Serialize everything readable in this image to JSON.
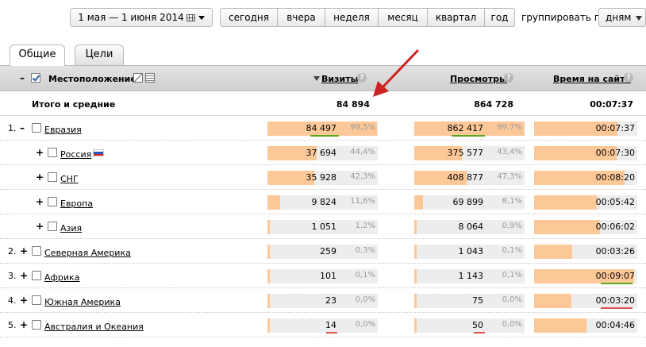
{
  "toolbar": {
    "date_range": "1 мая — 1 июня 2014",
    "periods": [
      "сегодня",
      "вчера",
      "неделя",
      "месяц",
      "квартал",
      "год"
    ],
    "group_label": "группировать по",
    "group_value": "дням"
  },
  "tabs": [
    "Общие",
    "Цели"
  ],
  "header": {
    "dimension": "Местоположение",
    "collapse": "–",
    "visits": "Визиты",
    "views": "Просмотры",
    "time": "Время на сайте",
    "help": "?"
  },
  "totals": {
    "label": "Итого и средние",
    "visits": "84 894",
    "views": "864 728",
    "time": "00:07:37"
  },
  "rows": [
    {
      "num": "1.",
      "toggle": "–",
      "name": "Евразия",
      "visits": "84 497",
      "visits_pct": "99,5%",
      "visits_frac": 0.995,
      "views": "862 417",
      "views_pct": "99,7%",
      "views_frac": 0.997,
      "time": "00:07:37",
      "time_frac": 0.81
    },
    {
      "num": "",
      "toggle": "+",
      "name": "Россия",
      "visits": "37 694",
      "visits_pct": "44,4%",
      "visits_frac": 0.444,
      "views": "375 577",
      "views_pct": "43,4%",
      "views_frac": 0.434,
      "time": "00:07:30",
      "time_frac": 0.8
    },
    {
      "num": "",
      "toggle": "+",
      "name": "СНГ",
      "visits": "35 928",
      "visits_pct": "42,3%",
      "visits_frac": 0.423,
      "views": "408 877",
      "views_pct": "47,3%",
      "views_frac": 0.473,
      "time": "00:08:20",
      "time_frac": 0.88
    },
    {
      "num": "",
      "toggle": "+",
      "name": "Европа",
      "visits": "9 824",
      "visits_pct": "11,6%",
      "visits_frac": 0.116,
      "views": "69 899",
      "views_pct": "8,1%",
      "views_frac": 0.081,
      "time": "00:05:42",
      "time_frac": 0.61
    },
    {
      "num": "",
      "toggle": "+",
      "name": "Азия",
      "visits": "1 051",
      "visits_pct": "1,2%",
      "visits_frac": 0.012,
      "views": "8 064",
      "views_pct": "0,9%",
      "views_frac": 0.009,
      "time": "00:06:02",
      "time_frac": 0.64
    },
    {
      "num": "2.",
      "toggle": "+",
      "name": "Северная Америка",
      "visits": "259",
      "visits_pct": "0,3%",
      "visits_frac": 0.003,
      "views": "1 043",
      "views_pct": "0,1%",
      "views_frac": 0.001,
      "time": "00:03:26",
      "time_frac": 0.37
    },
    {
      "num": "3.",
      "toggle": "+",
      "name": "Африка",
      "visits": "101",
      "visits_pct": "0,1%",
      "visits_frac": 0.001,
      "views": "1 143",
      "views_pct": "0,1%",
      "views_frac": 0.001,
      "time": "00:09:07",
      "time_frac": 0.97
    },
    {
      "num": "4.",
      "toggle": "+",
      "name": "Южная Америка",
      "visits": "23",
      "visits_pct": "0,0%",
      "visits_frac": 0.0,
      "views": "75",
      "views_pct": "0,0%",
      "views_frac": 0.0,
      "time": "00:03:20",
      "time_frac": 0.36
    },
    {
      "num": "5.",
      "toggle": "+",
      "name": "Австралия и Океания",
      "visits": "14",
      "visits_pct": "0,0%",
      "visits_frac": 0.0,
      "views": "50",
      "views_pct": "0,0%",
      "views_frac": 0.0,
      "time": "00:04:46",
      "time_frac": 0.51
    }
  ],
  "colors": {
    "bar_fill": "#fdc898",
    "bar_track": "#ededed",
    "highlight_good": "#5aa820",
    "highlight_bad": "#d9534f",
    "arrow": "#cc2222"
  }
}
